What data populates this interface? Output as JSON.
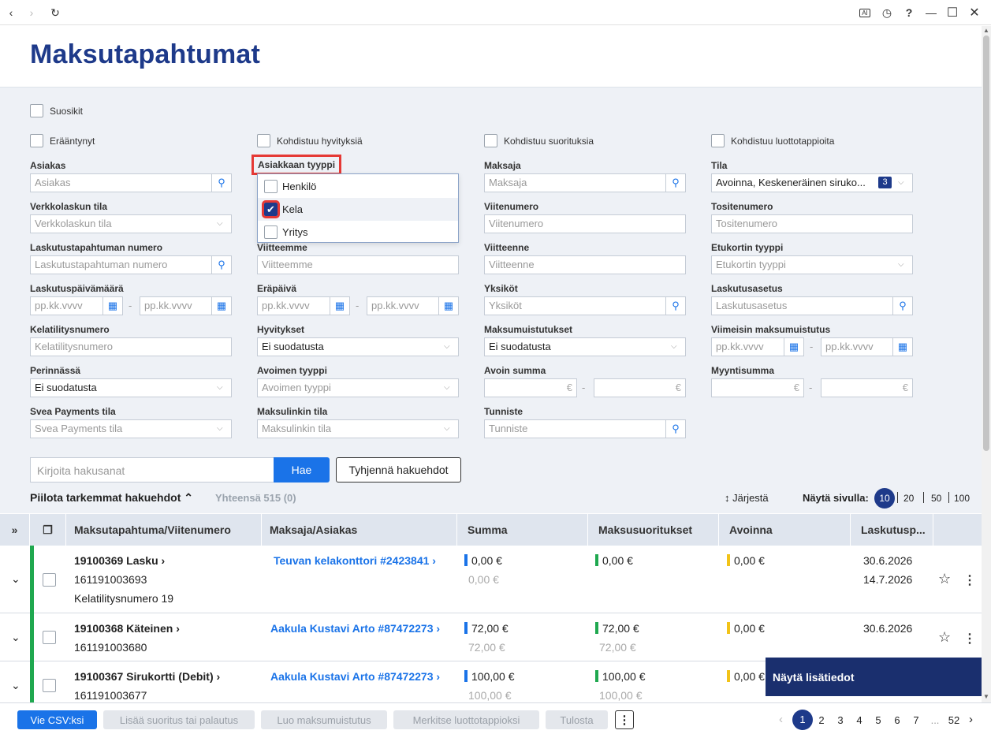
{
  "page": {
    "title": "Maksutapahtumat"
  },
  "checkboxes": {
    "suosikit": "Suosikit",
    "eraantynyt": "Erääntynyt",
    "hyvityksia": "Kohdistuu hyvityksiä",
    "suorituksia": "Kohdistuu suorituksia",
    "luottotappioita": "Kohdistuu luottotappioita"
  },
  "filters": {
    "asiakas": {
      "label": "Asiakas",
      "placeholder": "Asiakas"
    },
    "asiakkaan_tyyppi": {
      "label": "Asiakkaan tyyppi",
      "options": [
        {
          "label": "Henkilö",
          "checked": false
        },
        {
          "label": "Kela",
          "checked": true
        },
        {
          "label": "Yritys",
          "checked": false
        }
      ]
    },
    "maksaja": {
      "label": "Maksaja",
      "placeholder": "Maksaja"
    },
    "tila": {
      "label": "Tila",
      "value": "Avoinna, Keskeneräinen siruko...",
      "count": "3"
    },
    "verkkolaskun_tila": {
      "label": "Verkkolaskun tila",
      "placeholder": "Verkkolaskun tila"
    },
    "viitenumero": {
      "label": "Viitenumero",
      "placeholder": "Viitenumero"
    },
    "tositenumero": {
      "label": "Tositenumero",
      "placeholder": "Tositenumero"
    },
    "laskutustapahtuman_numero": {
      "label": "Laskutustapahtuman numero",
      "placeholder": "Laskutustapahtuman numero"
    },
    "viitteemme": {
      "label": "Viitteemme",
      "placeholder": "Viitteemme"
    },
    "viitteenne": {
      "label": "Viitteenne",
      "placeholder": "Viitteenne"
    },
    "etukortin_tyyppi": {
      "label": "Etukortin tyyppi",
      "placeholder": "Etukortin tyyppi"
    },
    "laskutuspaivamaara": {
      "label": "Laskutuspäivämäärä",
      "placeholder": "pp.kk.vvvv"
    },
    "erapaiva": {
      "label": "Eräpäivä",
      "placeholder": "pp.kk.vvvv"
    },
    "yksikot": {
      "label": "Yksiköt",
      "placeholder": "Yksiköt"
    },
    "laskutusasetus": {
      "label": "Laskutusasetus",
      "placeholder": "Laskutusasetus"
    },
    "kelatilitysnumero": {
      "label": "Kelatilitysnumero",
      "placeholder": "Kelatilitysnumero"
    },
    "hyvitykset": {
      "label": "Hyvitykset",
      "value": "Ei suodatusta"
    },
    "maksumuistutukset": {
      "label": "Maksumuistutukset",
      "value": "Ei suodatusta"
    },
    "viimeisin_maksumuistutus": {
      "label": "Viimeisin maksumuistutus",
      "placeholder": "pp.kk.vvvv"
    },
    "perinnassa": {
      "label": "Perinnässä",
      "value": "Ei suodatusta"
    },
    "avoimen_tyyppi": {
      "label": "Avoimen tyyppi",
      "placeholder": "Avoimen tyyppi"
    },
    "avoin_summa": {
      "label": "Avoin summa",
      "unit": "€"
    },
    "myyntisumma": {
      "label": "Myyntisumma",
      "unit": "€"
    },
    "svea_payments_tila": {
      "label": "Svea Payments tila",
      "placeholder": "Svea Payments tila"
    },
    "maksulinkin_tila": {
      "label": "Maksulinkin tila",
      "placeholder": "Maksulinkin tila"
    },
    "tunniste": {
      "label": "Tunniste",
      "placeholder": "Tunniste"
    }
  },
  "search": {
    "placeholder": "Kirjoita hakusanat",
    "submit": "Hae",
    "clear": "Tyhjennä hakuehdot"
  },
  "summary": {
    "hide": "Piilota tarkemmat hakuehdot",
    "total": "Yhteensä 515 (0)",
    "sort": "Järjestä",
    "per_page_label": "Näytä sivulla:",
    "per_page": [
      "10",
      "20",
      "50",
      "100"
    ]
  },
  "table": {
    "headers": [
      "Maksutapahtuma/Viitenumero",
      "Maksaja/Asiakas",
      "Summa",
      "Maksusuoritukset",
      "Avoinna",
      "Laskutusp..."
    ],
    "rows": [
      {
        "title": "19100369 Lasku",
        "ref": "161191003693",
        "extra": "Kelatilitysnumero 19",
        "payer": "Teuvan kelakonttori #2423841",
        "sum": "0,00 €",
        "sum2": "0,00 €",
        "payments": "0,00 €",
        "payments2": "",
        "open": "0,00 €",
        "date1": "30.6.2026",
        "date2": "14.7.2026"
      },
      {
        "title": "19100368 Käteinen",
        "ref": "161191003680",
        "extra": "",
        "payer": "Aakula Kustavi Arto #87472273",
        "sum": "72,00 €",
        "sum2": "72,00 €",
        "payments": "72,00 €",
        "payments2": "72,00 €",
        "open": "0,00 €",
        "date1": "30.6.2026",
        "date2": ""
      },
      {
        "title": "19100367 Sirukortti (Debit)",
        "ref": "161191003677",
        "extra": "",
        "payer": "Aakula Kustavi Arto #87472273",
        "sum": "100,00 €",
        "sum2": "100,00 €",
        "payments": "100,00 €",
        "payments2": "100,00 €",
        "open": "0,00 €",
        "date1": "",
        "date2": ""
      }
    ]
  },
  "overlay": {
    "details": "Näytä lisätiedot"
  },
  "bottom": {
    "csv": "Vie CSV:ksi",
    "add_payment": "Lisää suoritus tai palautus",
    "reminder": "Luo maksumuistutus",
    "credit_loss": "Merkitse luottotappioksi",
    "print": "Tulosta",
    "pages": [
      "1",
      "2",
      "3",
      "4",
      "5",
      "6",
      "7",
      "...",
      "52"
    ]
  },
  "colors": {
    "brand": "#1e3a8a",
    "accent": "#1a73e8",
    "green": "#1fa84f",
    "yellow": "#f2c318"
  }
}
